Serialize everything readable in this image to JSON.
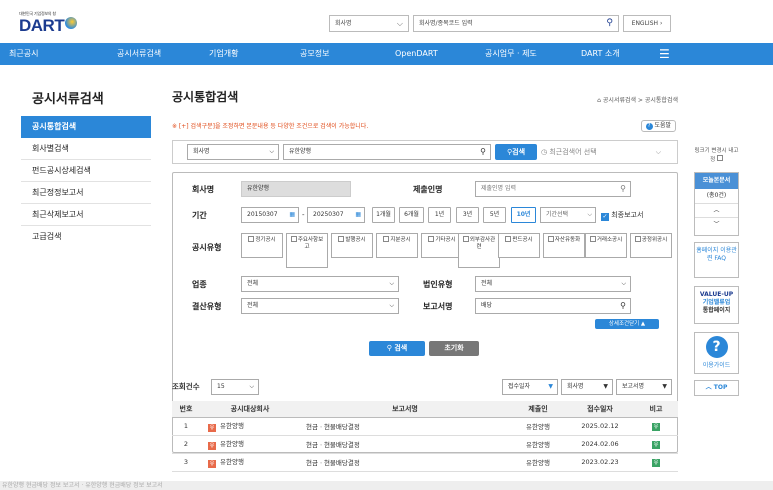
{
  "header": {
    "logo_small": "대한민국 기업정보의 창",
    "logo_big": "DART",
    "company_select": "회사명",
    "search_placeholder": "회사명/종목코드 입력",
    "english": "ENGLISH"
  },
  "nav": [
    "최근공시",
    "공시서류검색",
    "기업개황",
    "공모정보",
    "OpenDART",
    "공시업무 · 제도",
    "DART 소개"
  ],
  "sidebar": {
    "title": "공시서류검색",
    "items": [
      "공시통합검색",
      "회사별검색",
      "펀드공시상세검색",
      "최근정정보고서",
      "최근삭제보고서",
      "고급검색"
    ]
  },
  "main": {
    "title": "공시통합검색",
    "breadcrumb": "공시서류검색 > 공시통합검색",
    "note": "※ [+] 검색구분]을 조정하면 본문내용 등 다양한 조건으로 검색이 가능합니다.",
    "help": "도움말",
    "search": {
      "select": "회사명",
      "value": "유한양행",
      "button": "검색",
      "recent": "최근검색어 선택"
    },
    "form": {
      "company_label": "회사명",
      "company_value": "유한양행",
      "submitter_label": "제출인명",
      "submitter_placeholder": "제출인명 입력",
      "period_label": "기간",
      "start": "20150307",
      "end": "20250307",
      "periods": [
        "1개월",
        "6개월",
        "1년",
        "3년",
        "5년",
        "10년"
      ],
      "period_select": "기간선택",
      "final_report": "최종보고서",
      "type_label": "공시유형",
      "types": [
        "정기공시",
        "주요사항보고",
        "발행공시",
        "지분공시",
        "기타공시",
        "외부감사관련",
        "펀드공시",
        "자산유동화",
        "거래소공시",
        "공정위공시"
      ],
      "industry_label": "업종",
      "industry_value": "전체",
      "corp_label": "법인유형",
      "corp_value": "전체",
      "settle_label": "결산유형",
      "settle_value": "전체",
      "report_label": "보고서명",
      "report_value": "배당",
      "detail": "상세조건닫기 ▲",
      "search_btn": "검색",
      "reset_btn": "초기화"
    },
    "results": {
      "count_label": "조회건수",
      "count_value": "15",
      "sort": [
        "접수일자",
        "회사명",
        "보고서명"
      ],
      "headers": [
        "번호",
        "공시대상회사",
        "보고서명",
        "제출인",
        "접수일자",
        "비고"
      ],
      "rows": [
        {
          "no": "1",
          "company": "유한양행",
          "tag": "유",
          "report": "현금ㆍ현물배당결정",
          "submitter": "유한양행",
          "date": "2025.02.12",
          "note": "유"
        },
        {
          "no": "2",
          "company": "유한양행",
          "tag": "유",
          "report": "현금ㆍ현물배당결정",
          "submitter": "유한양행",
          "date": "2024.02.06",
          "note": "유"
        },
        {
          "no": "3",
          "company": "유한양행",
          "tag": "유",
          "report": "현금ㆍ현물배당결정",
          "submitter": "유한양행",
          "date": "2023.02.23",
          "note": "유"
        }
      ]
    }
  },
  "right": {
    "tip": "링크기 변경시 내고정",
    "opinion": "모놀본문서",
    "count": "(총0건)",
    "guide": "홈페이지 이용관련 FAQ",
    "value_up_1": "VALUE-UP",
    "value_up_2": "기업밸류업",
    "value_up_3": "통합페이지",
    "use_guide": "이용가이드",
    "top": "TOP"
  },
  "footer": "유한양행 현금배당 정보 보고서 · 유한양행 현금배당 정보 보고서"
}
